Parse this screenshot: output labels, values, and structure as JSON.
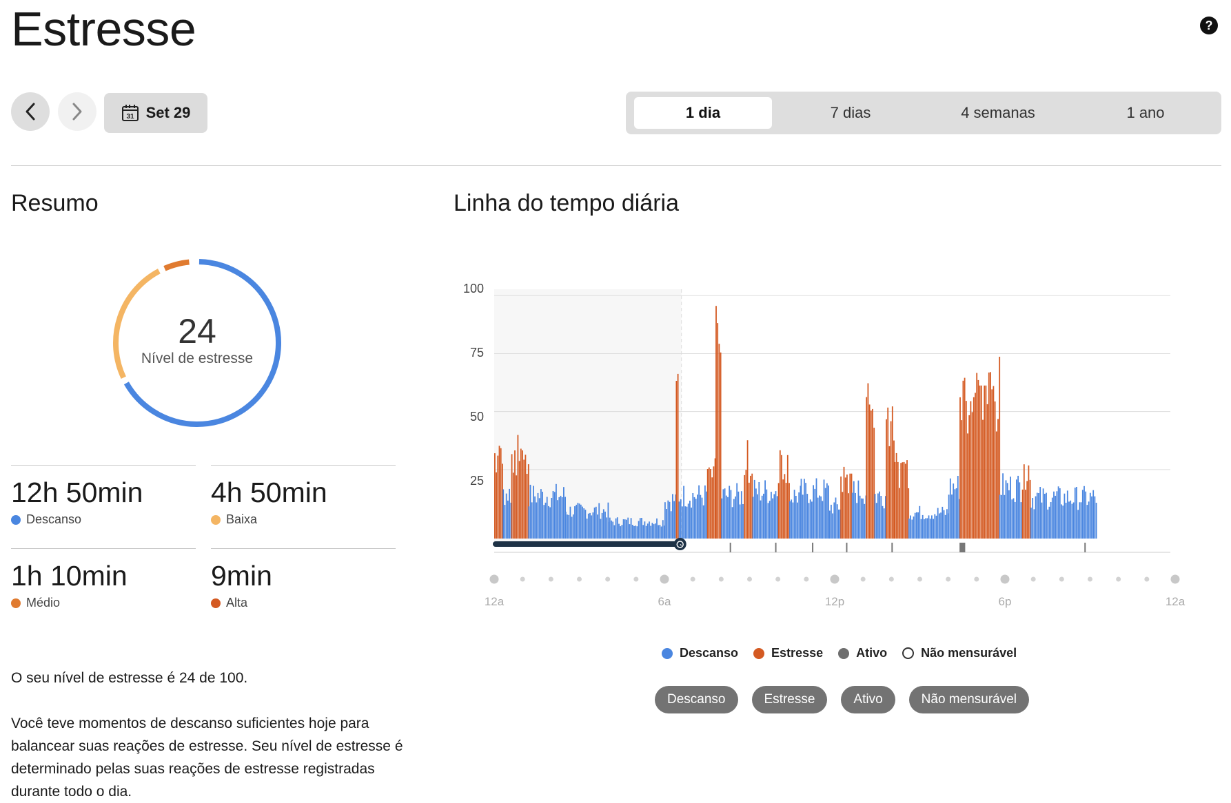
{
  "page": {
    "title": "Estresse",
    "help": "?"
  },
  "nav": {
    "date_label": "Set 29",
    "calendar_day": "31"
  },
  "range_tabs": [
    {
      "label": "1 dia",
      "active": true
    },
    {
      "label": "7 dias",
      "active": false
    },
    {
      "label": "4 semanas",
      "active": false
    },
    {
      "label": "1 ano",
      "active": false
    }
  ],
  "summary": {
    "title": "Resumo",
    "score": "24",
    "score_label": "Nível de estresse",
    "donut_fractions": {
      "descanso": 0.711,
      "baixa": 0.268,
      "medio": 0.065,
      "alta": 0.008
    },
    "stats": [
      {
        "value": "12h 50min",
        "label": "Descanso",
        "color": "#4a86e0"
      },
      {
        "value": "4h 50min",
        "label": "Baixa",
        "color": "#f4b563"
      },
      {
        "value": "1h 10min",
        "label": "Médio",
        "color": "#e07b30"
      },
      {
        "value": "9min",
        "label": "Alta",
        "color": "#d45a22"
      }
    ],
    "paragraph1": "O seu nível de estresse é 24 de 100.",
    "paragraph2": "Você teve momentos de descanso suficientes hoje para balancear suas reações de estresse. Seu nível de estresse é determinado pelas suas reações de estresse registradas durante todo o dia."
  },
  "timeline": {
    "title": "Linha do tempo diária",
    "y_ticks": [
      "100",
      "75",
      "50",
      "25"
    ],
    "x_ticks": [
      "12a",
      "6a",
      "12p",
      "6p",
      "12a"
    ]
  },
  "legend": [
    {
      "label": "Descanso",
      "color": "#4a86e0",
      "type": "filled"
    },
    {
      "label": "Estresse",
      "color": "#d45a22",
      "type": "filled"
    },
    {
      "label": "Ativo",
      "color": "#6e6e6e",
      "type": "filled"
    },
    {
      "label": "Não mensurável",
      "color": "#ffffff",
      "type": "outline"
    }
  ],
  "filters": [
    "Descanso",
    "Estresse",
    "Ativo",
    "Não mensurável"
  ],
  "chart_data": {
    "type": "bar",
    "x_unit": "hours",
    "ylim": [
      0,
      100
    ],
    "xlim": [
      0,
      24
    ],
    "y_ticks": [
      25,
      50,
      75,
      100
    ],
    "x_tick_labels": [
      "12a",
      "6a",
      "12p",
      "6p",
      "12a"
    ],
    "sleep_range": [
      0,
      6.6
    ],
    "segments": [
      {
        "start": 0.0,
        "end": 0.3,
        "type": "stress",
        "level": 40
      },
      {
        "start": 0.3,
        "end": 0.6,
        "type": "rest",
        "level": 21
      },
      {
        "start": 0.6,
        "end": 1.2,
        "type": "stress",
        "level": 38
      },
      {
        "start": 1.2,
        "end": 2.5,
        "type": "rest",
        "level": 20
      },
      {
        "start": 2.5,
        "end": 4.0,
        "type": "rest",
        "level": 13
      },
      {
        "start": 4.0,
        "end": 6.0,
        "type": "rest",
        "level": 8
      },
      {
        "start": 6.0,
        "end": 6.4,
        "type": "rest",
        "level": 18
      },
      {
        "start": 6.4,
        "end": 6.5,
        "type": "stress",
        "level": 68
      },
      {
        "start": 6.5,
        "end": 7.5,
        "type": "rest",
        "level": 20
      },
      {
        "start": 7.5,
        "end": 7.8,
        "type": "stress",
        "level": 30
      },
      {
        "start": 7.8,
        "end": 8.0,
        "type": "stress",
        "level": 84
      },
      {
        "start": 8.0,
        "end": 8.8,
        "type": "rest",
        "level": 20
      },
      {
        "start": 8.8,
        "end": 9.1,
        "type": "stress",
        "level": 36
      },
      {
        "start": 9.1,
        "end": 10.0,
        "type": "rest",
        "level": 22
      },
      {
        "start": 10.0,
        "end": 10.4,
        "type": "stress",
        "level": 36
      },
      {
        "start": 10.4,
        "end": 10.8,
        "type": "rest",
        "level": 20
      },
      {
        "start": 10.8,
        "end": 11.8,
        "type": "rest",
        "level": 22
      },
      {
        "start": 11.8,
        "end": 12.2,
        "type": "rest",
        "level": 15
      },
      {
        "start": 12.2,
        "end": 12.6,
        "type": "stress",
        "level": 28
      },
      {
        "start": 12.6,
        "end": 13.1,
        "type": "rest",
        "level": 22
      },
      {
        "start": 13.1,
        "end": 13.4,
        "type": "stress",
        "level": 61
      },
      {
        "start": 13.4,
        "end": 13.8,
        "type": "rest",
        "level": 20
      },
      {
        "start": 13.8,
        "end": 14.1,
        "type": "stress",
        "level": 57
      },
      {
        "start": 14.1,
        "end": 14.6,
        "type": "stress",
        "level": 33
      },
      {
        "start": 14.6,
        "end": 16.0,
        "type": "rest",
        "level": 12
      },
      {
        "start": 16.0,
        "end": 16.4,
        "type": "rest",
        "level": 24
      },
      {
        "start": 16.4,
        "end": 17.8,
        "type": "stress",
        "level": 66
      },
      {
        "start": 17.8,
        "end": 18.6,
        "type": "rest",
        "level": 24
      },
      {
        "start": 18.6,
        "end": 18.9,
        "type": "stress",
        "level": 32
      },
      {
        "start": 18.9,
        "end": 21.2,
        "type": "rest",
        "level": 19
      }
    ],
    "sleep_marker": "alarm-clock",
    "active_ticks_hours": [
      8.3,
      9.9,
      11.2,
      12.4,
      14.0,
      16.5,
      20.8
    ],
    "active_block": [
      16.4,
      16.6
    ]
  }
}
